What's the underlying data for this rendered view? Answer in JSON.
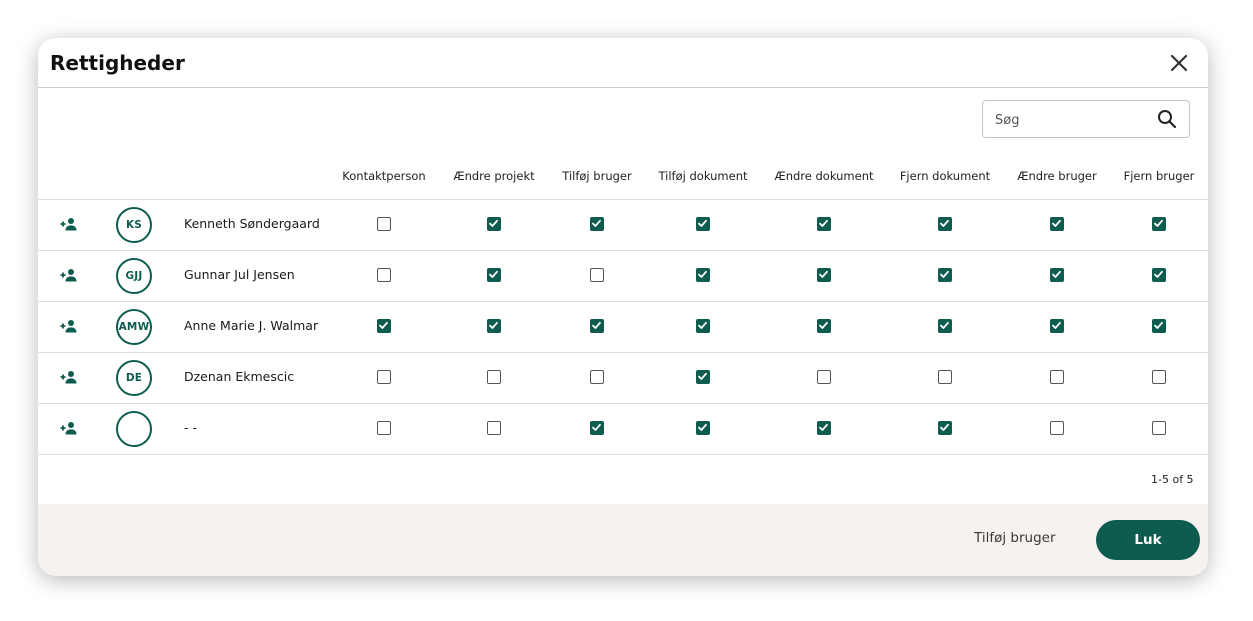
{
  "dialog": {
    "title": "Rettigheder",
    "close_icon": "close-icon"
  },
  "search": {
    "placeholder": "Søg",
    "value": "",
    "icon": "search-icon"
  },
  "table": {
    "columns": [
      "Kontaktperson",
      "Ændre projekt",
      "Tilføj bruger",
      "Tilføj dokument",
      "Ændre dokument",
      "Fjern dokument",
      "Ændre bruger",
      "Fjern bruger"
    ],
    "rows": [
      {
        "initials": "KS",
        "name": "Kenneth Søndergaard",
        "permissions": [
          false,
          true,
          true,
          true,
          true,
          true,
          true,
          true
        ]
      },
      {
        "initials": "GJJ",
        "name": "Gunnar Jul Jensen",
        "permissions": [
          false,
          true,
          false,
          true,
          true,
          true,
          true,
          true
        ]
      },
      {
        "initials": "AMW",
        "name": "Anne Marie J. Walmar",
        "permissions": [
          true,
          true,
          true,
          true,
          true,
          true,
          true,
          true
        ]
      },
      {
        "initials": "DE",
        "name": "Dzenan Ekmescic",
        "permissions": [
          false,
          false,
          false,
          true,
          false,
          false,
          false,
          false
        ]
      },
      {
        "initials": "",
        "name": "- -",
        "permissions": [
          false,
          false,
          true,
          true,
          true,
          true,
          false,
          false
        ]
      }
    ],
    "row_icon": "add-person-icon"
  },
  "pagination": {
    "text": "1-5 of 5"
  },
  "footer": {
    "add_user_label": "Tilføj bruger",
    "close_label": "Luk"
  },
  "colors": {
    "accent": "#0e5c4f",
    "footer_bg": "#f5f2ef"
  }
}
